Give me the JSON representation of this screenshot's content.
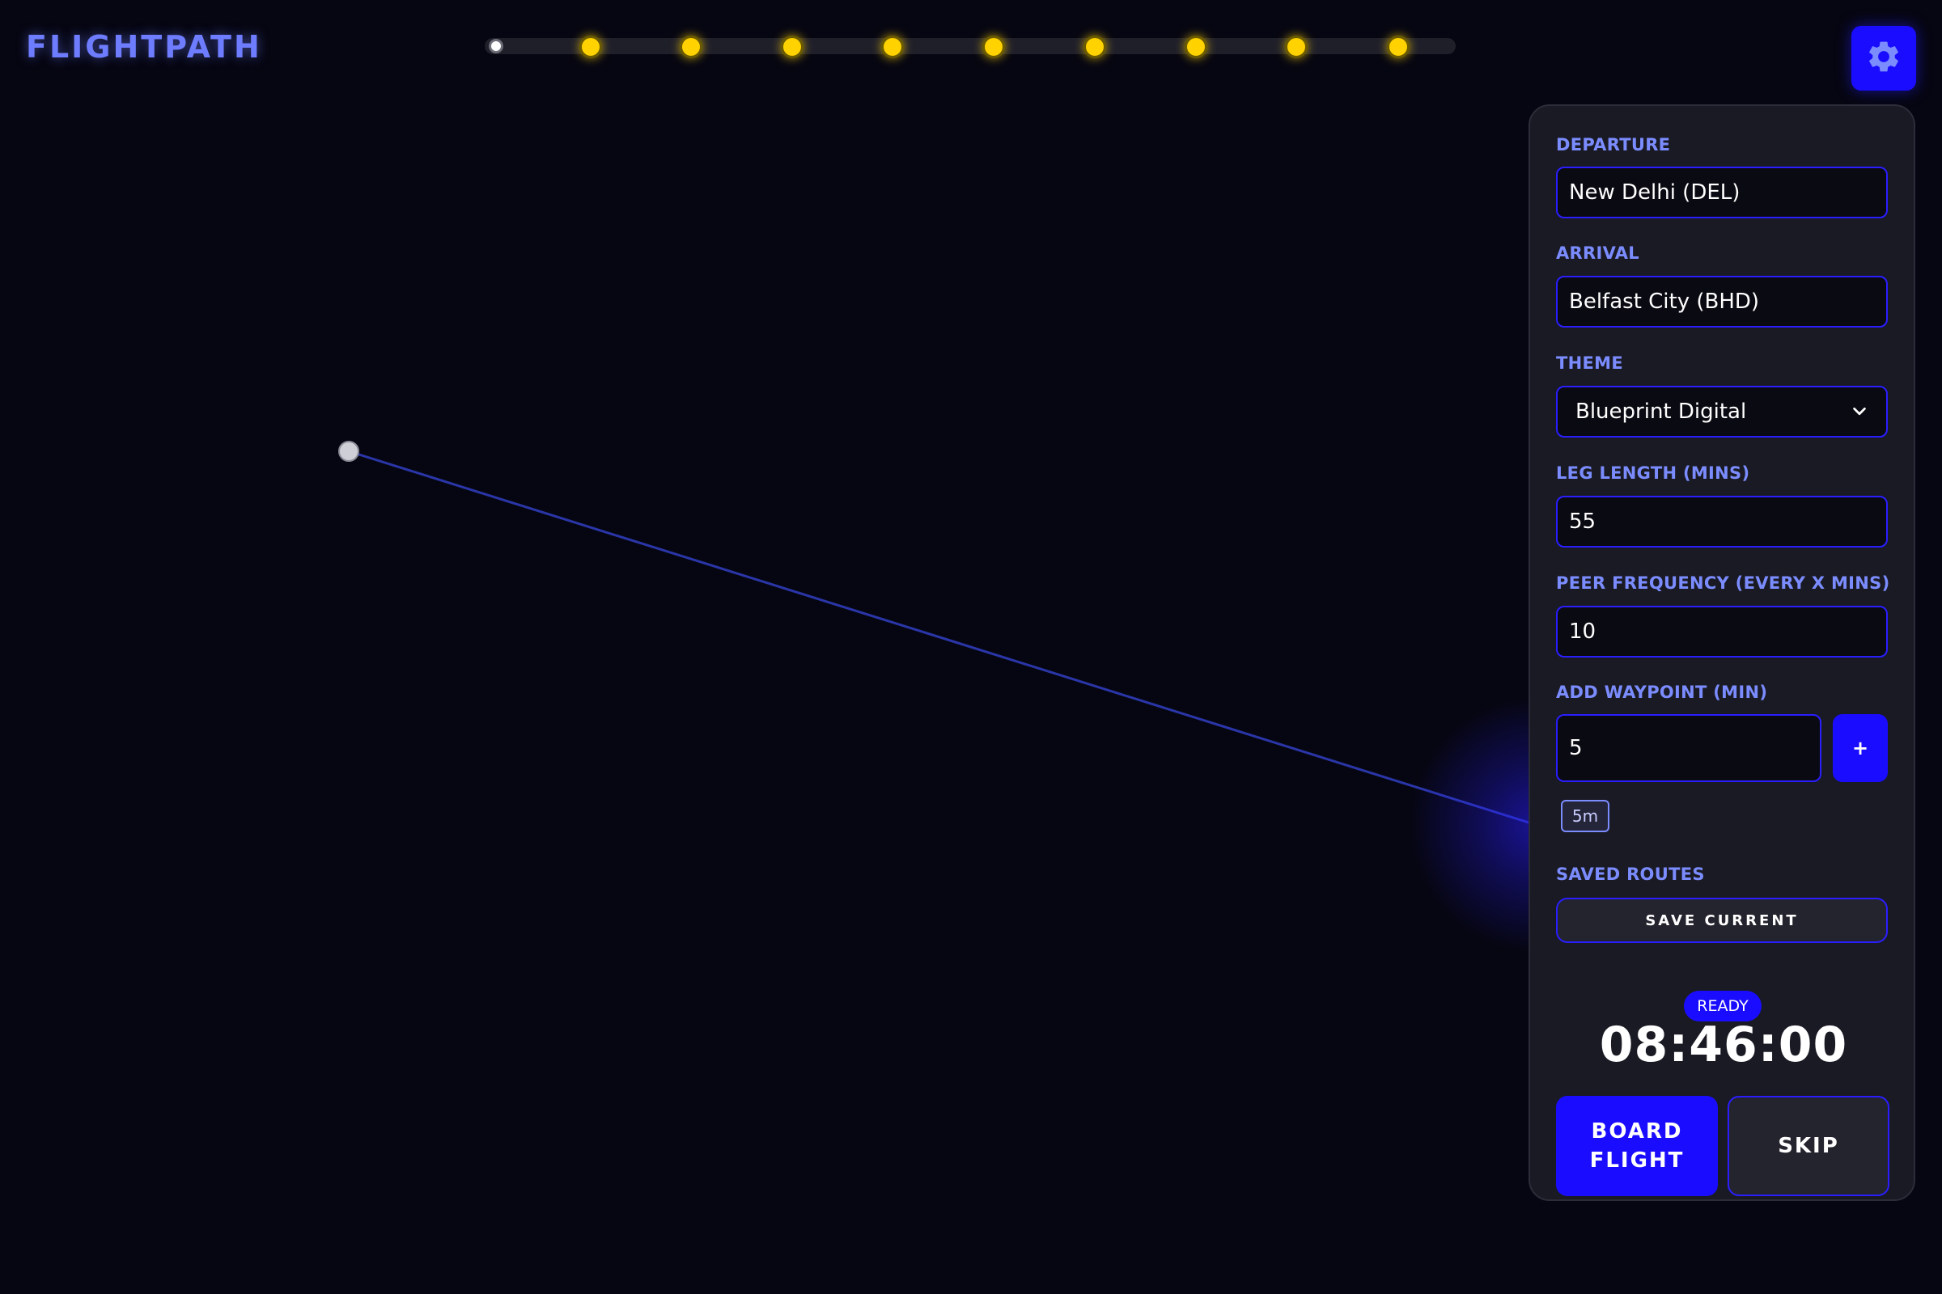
{
  "app": {
    "title": "FLIGHTPATH"
  },
  "progress": {
    "total_stops": 9,
    "current_position": 0
  },
  "settings": {
    "icon": "gear-icon"
  },
  "map": {
    "origin": "origin-marker",
    "route_color": "#2a36a8"
  },
  "form": {
    "departure": {
      "label": "DEPARTURE",
      "value": "New Delhi (DEL)"
    },
    "arrival": {
      "label": "ARRIVAL",
      "value": "Belfast City (BHD)"
    },
    "theme": {
      "label": "THEME",
      "value": "Blueprint Digital"
    },
    "leg_length": {
      "label": "LEG LENGTH (MINS)",
      "value": "55"
    },
    "peer_frequency": {
      "label": "PEER FREQUENCY (EVERY X MINS)",
      "value": "10"
    },
    "waypoint": {
      "label": "ADD WAYPOINT (MIN)",
      "value": "5",
      "add_label": "+",
      "chips": [
        "5m"
      ]
    },
    "saved_routes": {
      "label": "SAVED ROUTES",
      "save_label": "SAVE CURRENT"
    }
  },
  "status": {
    "badge": "READY",
    "clock": "08:46:00"
  },
  "actions": {
    "board_line1": "BOARD",
    "board_line2": "FLIGHT",
    "skip": "SKIP"
  },
  "colors": {
    "accent": "#1a0dff",
    "label": "#7b8cff",
    "stop": "#ffd200",
    "background": "#060612",
    "panel": "#1a1a24"
  }
}
